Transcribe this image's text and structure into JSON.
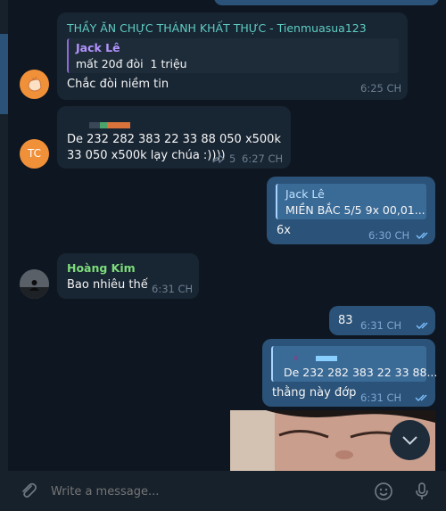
{
  "messages": {
    "m1": {
      "sender": "THẦY ĂN CHỰC THÁNH KHẤT THỰC - Tienmuasua123",
      "reply_name": "Jack Lê",
      "reply_text": "mất 20đ đòi  1 triệu",
      "text": "Chắc đòi niềm tin",
      "time": "6:25 CH"
    },
    "m2": {
      "avatar_initials": "TC",
      "line1": "De 232 282 383 22 33 88 050 x500k",
      "line2": "33 050 x500k lạy chúa :))))",
      "forward_count": "5",
      "time": "6:27 CH"
    },
    "m3": {
      "reply_name": "Jack Lê",
      "reply_text": "MIỀN BẮC 5/5 9x 00,01...",
      "text": "6x",
      "time": "6:30 CH"
    },
    "m4": {
      "sender": "Hoàng Kim",
      "text": "Bao nhiêu thế",
      "time": "6:31 CH"
    },
    "m5": {
      "text": "83",
      "time": "6:31 CH"
    },
    "m6": {
      "reply_text": "De 232 282 383 22 33 88...",
      "text": "thằng này đớp",
      "time": "6:31 CH"
    }
  },
  "composer": {
    "placeholder": "Write a message..."
  },
  "colors": {
    "background": "#0e1621",
    "incoming_bubble": "#182533",
    "outgoing_bubble": "#2b5278",
    "sender_teal": "#5fcdc3",
    "sender_green": "#7ddc7a",
    "reply_purple": "#b493ff",
    "reply_blue": "#bfe2ff"
  },
  "icons": [
    "attach-icon",
    "emoji-icon",
    "microphone-icon",
    "scroll-down-icon",
    "forward-icon",
    "double-check-icon"
  ]
}
